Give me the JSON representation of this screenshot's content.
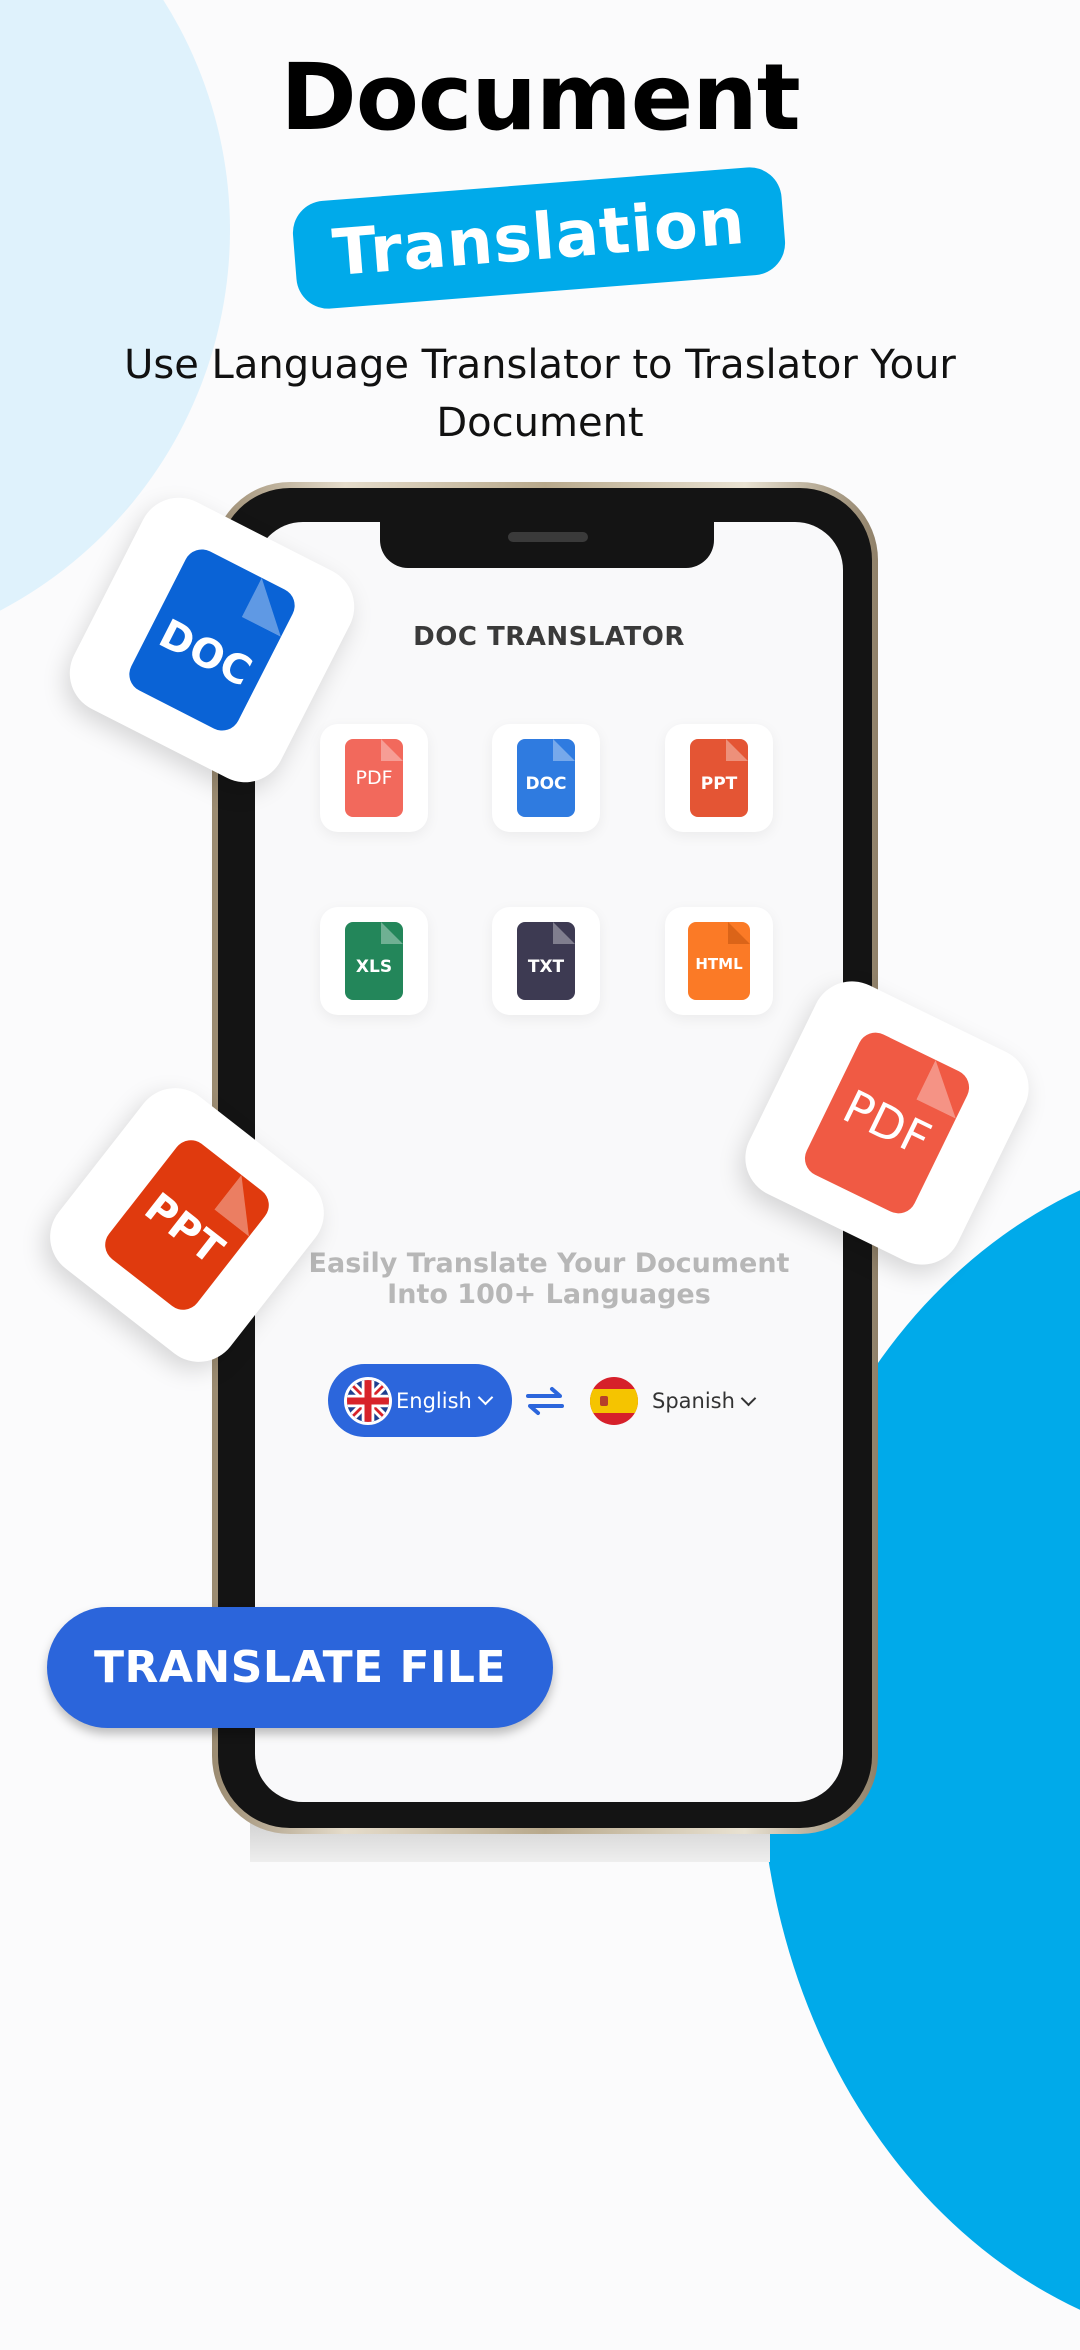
{
  "header": {
    "title": "Document",
    "badge": "Translation",
    "subtitle": "Use Language Translator to Traslator  Your Document"
  },
  "colors": {
    "accent_cyan": "#00aaea",
    "primary_blue": "#2b65db",
    "light_circle": "#dff2fc"
  },
  "floating_icons": [
    {
      "label": "DOC",
      "icon": "doc-file-icon",
      "color": "#0a63d6"
    },
    {
      "label": "PDF",
      "icon": "pdf-file-icon",
      "color": "#f05a44"
    },
    {
      "label": "PPT",
      "icon": "ppt-file-icon",
      "color": "#e03a0e"
    }
  ],
  "app": {
    "title": "DOC TRANSLATOR",
    "file_types": [
      {
        "label": "PDF",
        "icon": "pdf-file-icon",
        "color": "#f2695c"
      },
      {
        "label": "DOC",
        "icon": "doc-file-icon",
        "color": "#2f7be0"
      },
      {
        "label": "PPT",
        "icon": "ppt-file-icon",
        "color": "#e45534"
      },
      {
        "label": "XLS",
        "icon": "xls-file-icon",
        "color": "#23865a"
      },
      {
        "label": "TXT",
        "icon": "txt-file-icon",
        "color": "#3d3a52"
      },
      {
        "label": "HTML",
        "icon": "html-file-icon",
        "color": "#fb7a26"
      }
    ],
    "tagline_line1": "Easily Translate Your Document",
    "tagline_line2": "Into 100+ Languages",
    "source_language": "English",
    "target_language": "Spanish",
    "translate_button": "TRANSLATE FILE"
  }
}
